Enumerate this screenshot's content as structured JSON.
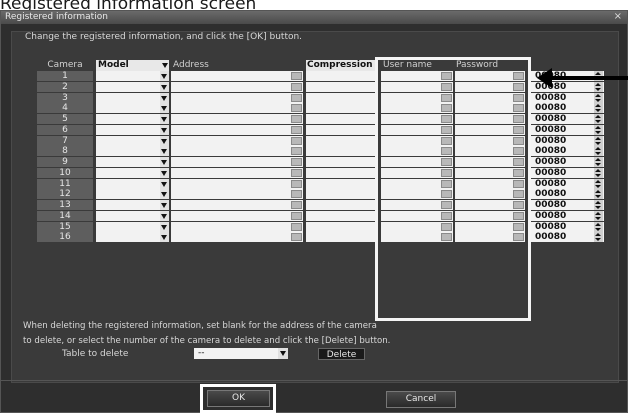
{
  "page": {
    "heading": "Registered information screen"
  },
  "dialog": {
    "title": "Registered information",
    "close_glyph": "×",
    "instruction": "Change the registered information, and click the [OK] button."
  },
  "table": {
    "headers": {
      "camera": "Camera",
      "model": "Model",
      "address": "Address",
      "compression": "Compression",
      "user_name": "User name",
      "password": "Password"
    },
    "rows": [
      {
        "camera": "1",
        "port": "00080"
      },
      {
        "camera": "2",
        "port": "00080"
      },
      {
        "camera": "3",
        "port": "00080"
      },
      {
        "camera": "4",
        "port": "00080"
      },
      {
        "camera": "5",
        "port": "00080"
      },
      {
        "camera": "6",
        "port": "00080"
      },
      {
        "camera": "7",
        "port": "00080"
      },
      {
        "camera": "8",
        "port": "00080"
      },
      {
        "camera": "9",
        "port": "00080"
      },
      {
        "camera": "10",
        "port": "00080"
      },
      {
        "camera": "11",
        "port": "00080"
      },
      {
        "camera": "12",
        "port": "00080"
      },
      {
        "camera": "13",
        "port": "00080"
      },
      {
        "camera": "14",
        "port": "00080"
      },
      {
        "camera": "15",
        "port": "00080"
      },
      {
        "camera": "16",
        "port": "00080"
      }
    ]
  },
  "notes": {
    "line1": "When deleting the registered information, set blank for the address of the camera",
    "line2": "to delete, or select the number of the camera to delete and click the [Delete] button."
  },
  "delete_section": {
    "label": "Table to delete",
    "selected": "--",
    "button": "Delete"
  },
  "footer": {
    "ok": "OK",
    "cancel": "Cancel"
  }
}
